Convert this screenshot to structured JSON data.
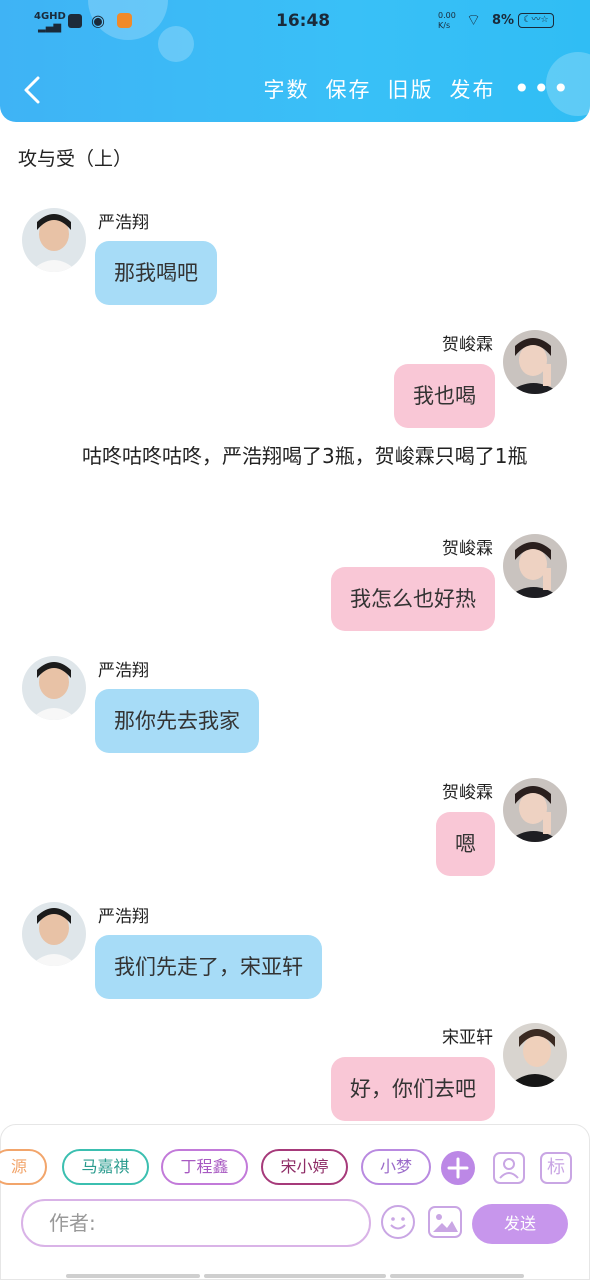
{
  "status_bar": {
    "network": "4GHD",
    "time": "16:48",
    "speed": "0.00 K/s",
    "battery": "8%"
  },
  "nav": {
    "actions": [
      "字数",
      "保存",
      "旧版",
      "发布"
    ],
    "more": "•••"
  },
  "document": {
    "title": "攻与受（上）",
    "messages": [
      {
        "side": "left",
        "name": "严浩翔",
        "text": "那我喝吧"
      },
      {
        "side": "right",
        "name": "贺峻霖",
        "text": "我也喝"
      },
      {
        "side": "right",
        "name": "贺峻霖",
        "text": "我怎么也好热"
      },
      {
        "side": "left",
        "name": "严浩翔",
        "text": "那你先去我家"
      },
      {
        "side": "right",
        "name": "贺峻霖",
        "text": "嗯"
      },
      {
        "side": "left",
        "name": "严浩翔",
        "text": "我们先走了，宋亚轩"
      },
      {
        "side": "right",
        "name": "宋亚轩",
        "text": "好，你们去吧"
      }
    ],
    "narration": "咕咚咕咚咕咚，严浩翔喝了3瓶，贺峻霖只喝了1瓶"
  },
  "composer": {
    "role_chips": [
      "源",
      "马嘉祺",
      "丁程鑫",
      "宋小婷",
      "小梦"
    ],
    "chip_colors": [
      "#f2a56b",
      "#3bbfb0",
      "#c27ad9",
      "#a63a7a",
      "#b98ae0"
    ],
    "input_placeholder": "作者:",
    "send_label": "发送",
    "icons": [
      "add-role-icon",
      "person-card-icon",
      "tag-icon",
      "emoji-icon",
      "image-icon"
    ]
  }
}
